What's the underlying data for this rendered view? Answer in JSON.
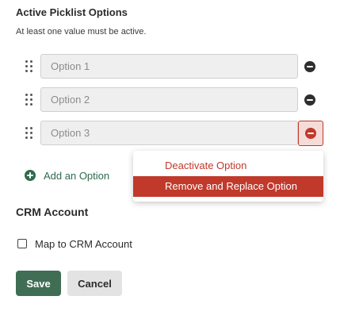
{
  "picklist": {
    "title": "Active Picklist Options",
    "subtitle": "At least one value must be active.",
    "options": [
      {
        "placeholder": "Option 1"
      },
      {
        "placeholder": "Option 2"
      },
      {
        "placeholder": "Option 3"
      }
    ],
    "add_label": "Add an Option"
  },
  "context_menu": {
    "deactivate_label": "Deactivate Option",
    "replace_label": "Remove and Replace Option"
  },
  "crm": {
    "title": "CRM Account",
    "checkbox_label": "Map to CRM Account",
    "checked": false
  },
  "actions": {
    "save_label": "Save",
    "cancel_label": "Cancel"
  },
  "colors": {
    "accent_green": "#3f6e54",
    "danger_red": "#c0392b"
  },
  "icons": {
    "drag": "drag-handle-icon",
    "remove": "minus-circle-icon",
    "add": "plus-circle-icon",
    "checkbox": "checkbox-icon"
  }
}
